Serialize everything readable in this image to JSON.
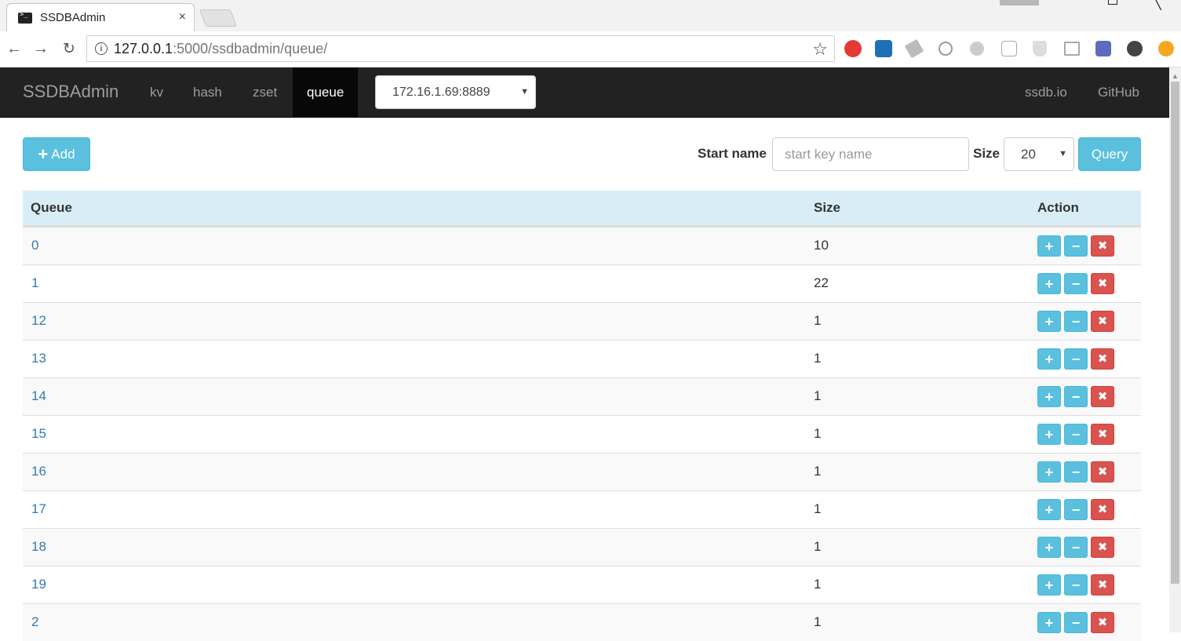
{
  "browser": {
    "tab_title": "SSDBAdmin",
    "tab_close": "×",
    "url_host": "127.0.0.1",
    "url_rest": ":5000/ssdbadmin/queue/"
  },
  "navbar": {
    "brand": "SSDBAdmin",
    "links": [
      {
        "label": "kv",
        "active": false
      },
      {
        "label": "hash",
        "active": false
      },
      {
        "label": "zset",
        "active": false
      },
      {
        "label": "queue",
        "active": true
      }
    ],
    "server": "172.16.1.69:8889",
    "right_links": [
      "ssdb.io",
      "GitHub"
    ]
  },
  "controls": {
    "add_label": "Add",
    "start_name_label": "Start name",
    "start_name_placeholder": "start key name",
    "size_label": "Size",
    "size_value": "20",
    "query_label": "Query"
  },
  "table": {
    "headers": [
      "Queue",
      "Size",
      "Action"
    ],
    "rows": [
      {
        "name": "0",
        "size": "10"
      },
      {
        "name": "1",
        "size": "22"
      },
      {
        "name": "12",
        "size": "1"
      },
      {
        "name": "13",
        "size": "1"
      },
      {
        "name": "14",
        "size": "1"
      },
      {
        "name": "15",
        "size": "1"
      },
      {
        "name": "16",
        "size": "1"
      },
      {
        "name": "17",
        "size": "1"
      },
      {
        "name": "18",
        "size": "1"
      },
      {
        "name": "19",
        "size": "1"
      },
      {
        "name": "2",
        "size": "1"
      }
    ]
  },
  "colors": {
    "info": "#5bc0de",
    "danger": "#d9534f",
    "navbar": "#222222",
    "link": "#337ab7",
    "thead": "#d9edf7"
  }
}
